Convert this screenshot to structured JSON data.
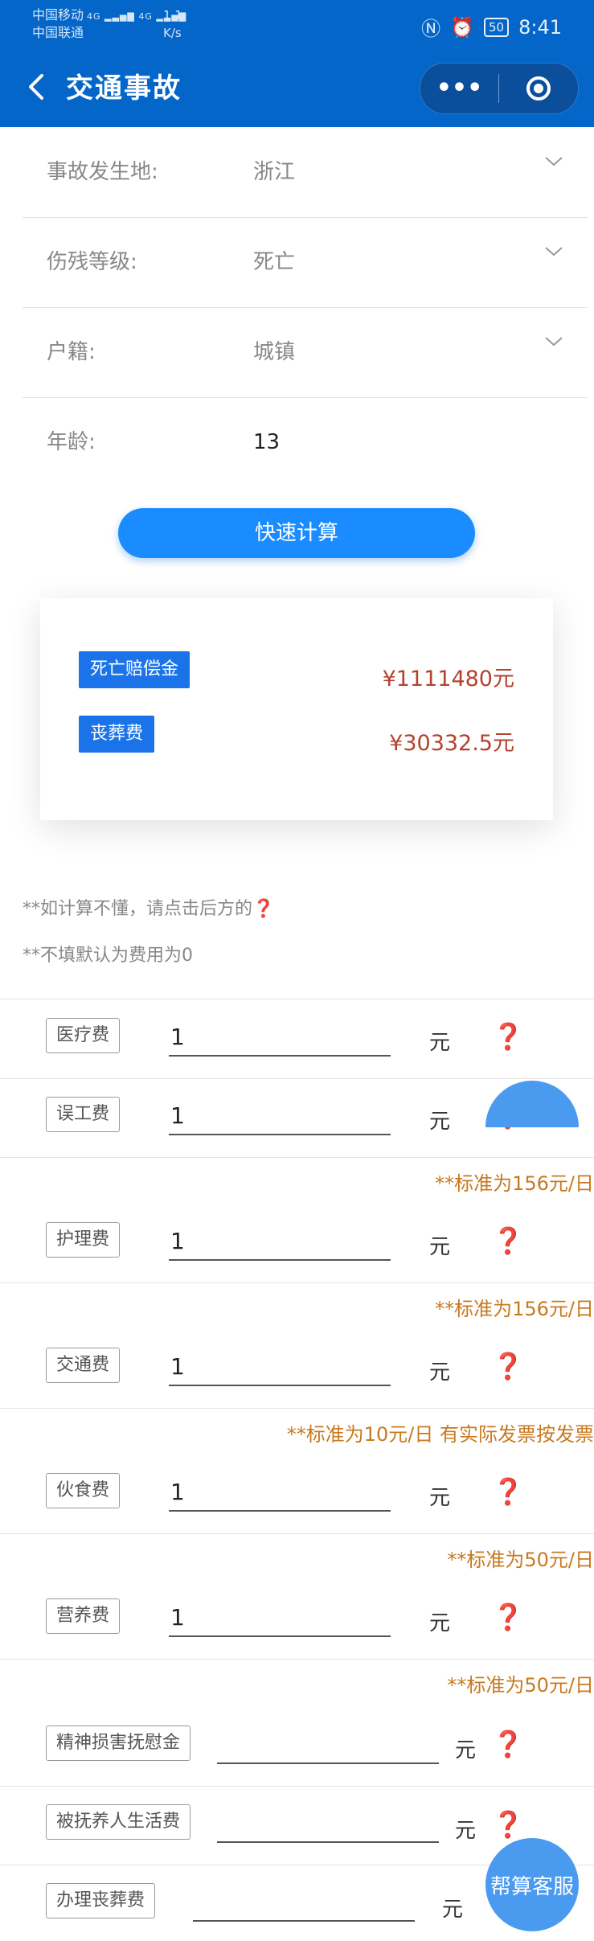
{
  "status_bar": {
    "carrier1": "中国移动",
    "carrier2": "中国联通",
    "signal1": "4G",
    "signal2": "4G",
    "speed_value": "1.1",
    "speed_unit": "K/s",
    "battery": "50",
    "time": "8:41",
    "icons": [
      "nfc-icon",
      "alarm-icon",
      "battery-icon"
    ]
  },
  "navbar": {
    "title": "交通事故",
    "back_icon": "chevron-left-icon",
    "more_label": "•••"
  },
  "form": {
    "place_label": "事故发生地:",
    "place_value": "浙江",
    "disability_label": "伤残等级:",
    "disability_value": "死亡",
    "residence_label": "户籍:",
    "residence_value": "城镇",
    "age_label": "年龄:",
    "age_value": "13"
  },
  "calc_button": "快速计算",
  "results": [
    {
      "label": "死亡赔偿金",
      "amount": "¥1111480元"
    },
    {
      "label": "丧葬费",
      "amount": "¥30332.5元"
    }
  ],
  "notes": {
    "note1": "**如计算不懂，请点击后方的",
    "note1_icon": "❓",
    "note2": "**不填默认为费用为0"
  },
  "fees": [
    {
      "label": "医疗费",
      "value": "1",
      "unit": "元",
      "hint": ""
    },
    {
      "label": "误工费",
      "value": "1",
      "unit": "元",
      "hint": "**标准为156元/日"
    },
    {
      "label": "护理费",
      "value": "1",
      "unit": "元",
      "hint": "**标准为156元/日"
    },
    {
      "label": "交通费",
      "value": "1",
      "unit": "元",
      "hint": "**标准为10元/日 有实际发票按发票"
    },
    {
      "label": "伙食费",
      "value": "1",
      "unit": "元",
      "hint": "**标准为50元/日"
    },
    {
      "label": "营养费",
      "value": "1",
      "unit": "元",
      "hint": "**标准为50元/日"
    },
    {
      "label": "精神损害抚慰金",
      "value": "",
      "unit": "元",
      "hint": ""
    },
    {
      "label": "被抚养人生活费",
      "value": "",
      "unit": "元",
      "hint": ""
    },
    {
      "label": "办理丧葬费",
      "value": "",
      "unit": "元",
      "hint": ""
    }
  ],
  "question_icon": "❓",
  "service_button": "帮算客服",
  "colors": {
    "primary": "#0466c8",
    "button": "#1a8cff",
    "amount": "#b3422f",
    "hint": "#c8791f",
    "question": "#c0272d"
  }
}
